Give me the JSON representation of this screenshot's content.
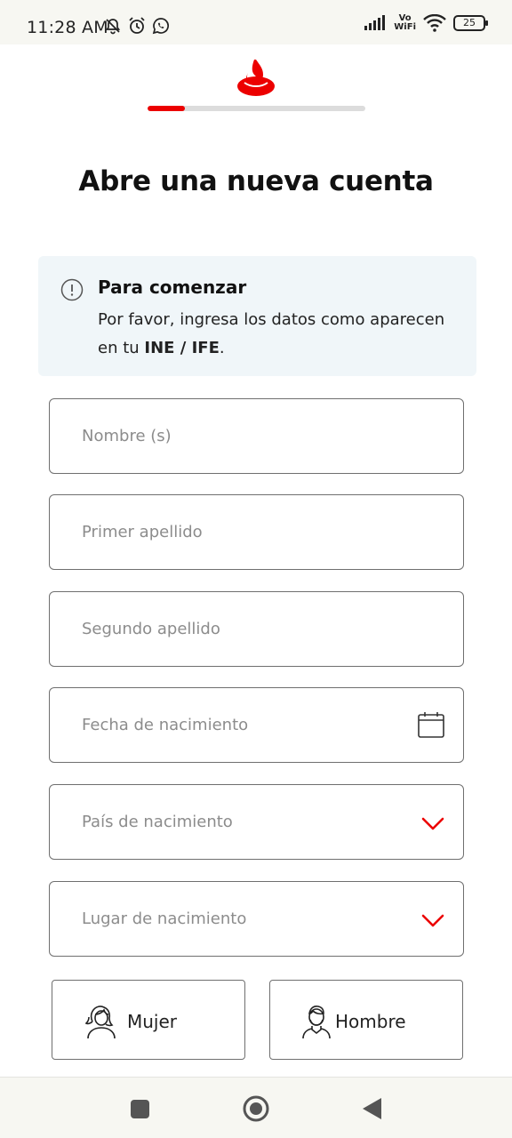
{
  "status_bar": {
    "time": "11:28 AM",
    "left_icons": [
      "bell-off-icon",
      "alarm-icon",
      "whatsapp-icon"
    ],
    "network_label_top": "Vo",
    "network_label_bottom": "WiFi",
    "battery": "25"
  },
  "brand": {
    "logo": "santander-flame-icon",
    "accent_color": "#ec0000"
  },
  "progress": {
    "fraction": 0.17
  },
  "page_title": "Abre una nueva cuenta",
  "info": {
    "icon": "info-exclamation-icon",
    "title": "Para comenzar",
    "body_prefix": "Por favor, ingresa los datos como aparecen en tu ",
    "body_bold": "INE / IFE",
    "body_suffix": "."
  },
  "form": {
    "first_name_placeholder": "Nombre (s)",
    "last_name_placeholder": "Primer apellido",
    "second_last_name_placeholder": "Segundo apellido",
    "birth_date_placeholder": "Fecha de nacimiento",
    "birth_country_placeholder": "País de nacimiento",
    "birth_place_placeholder": "Lugar de nacimiento"
  },
  "gender": {
    "female_label": "Mujer",
    "male_label": "Hombre"
  },
  "nav": [
    "recents-square-icon",
    "home-circle-icon",
    "back-triangle-icon"
  ]
}
